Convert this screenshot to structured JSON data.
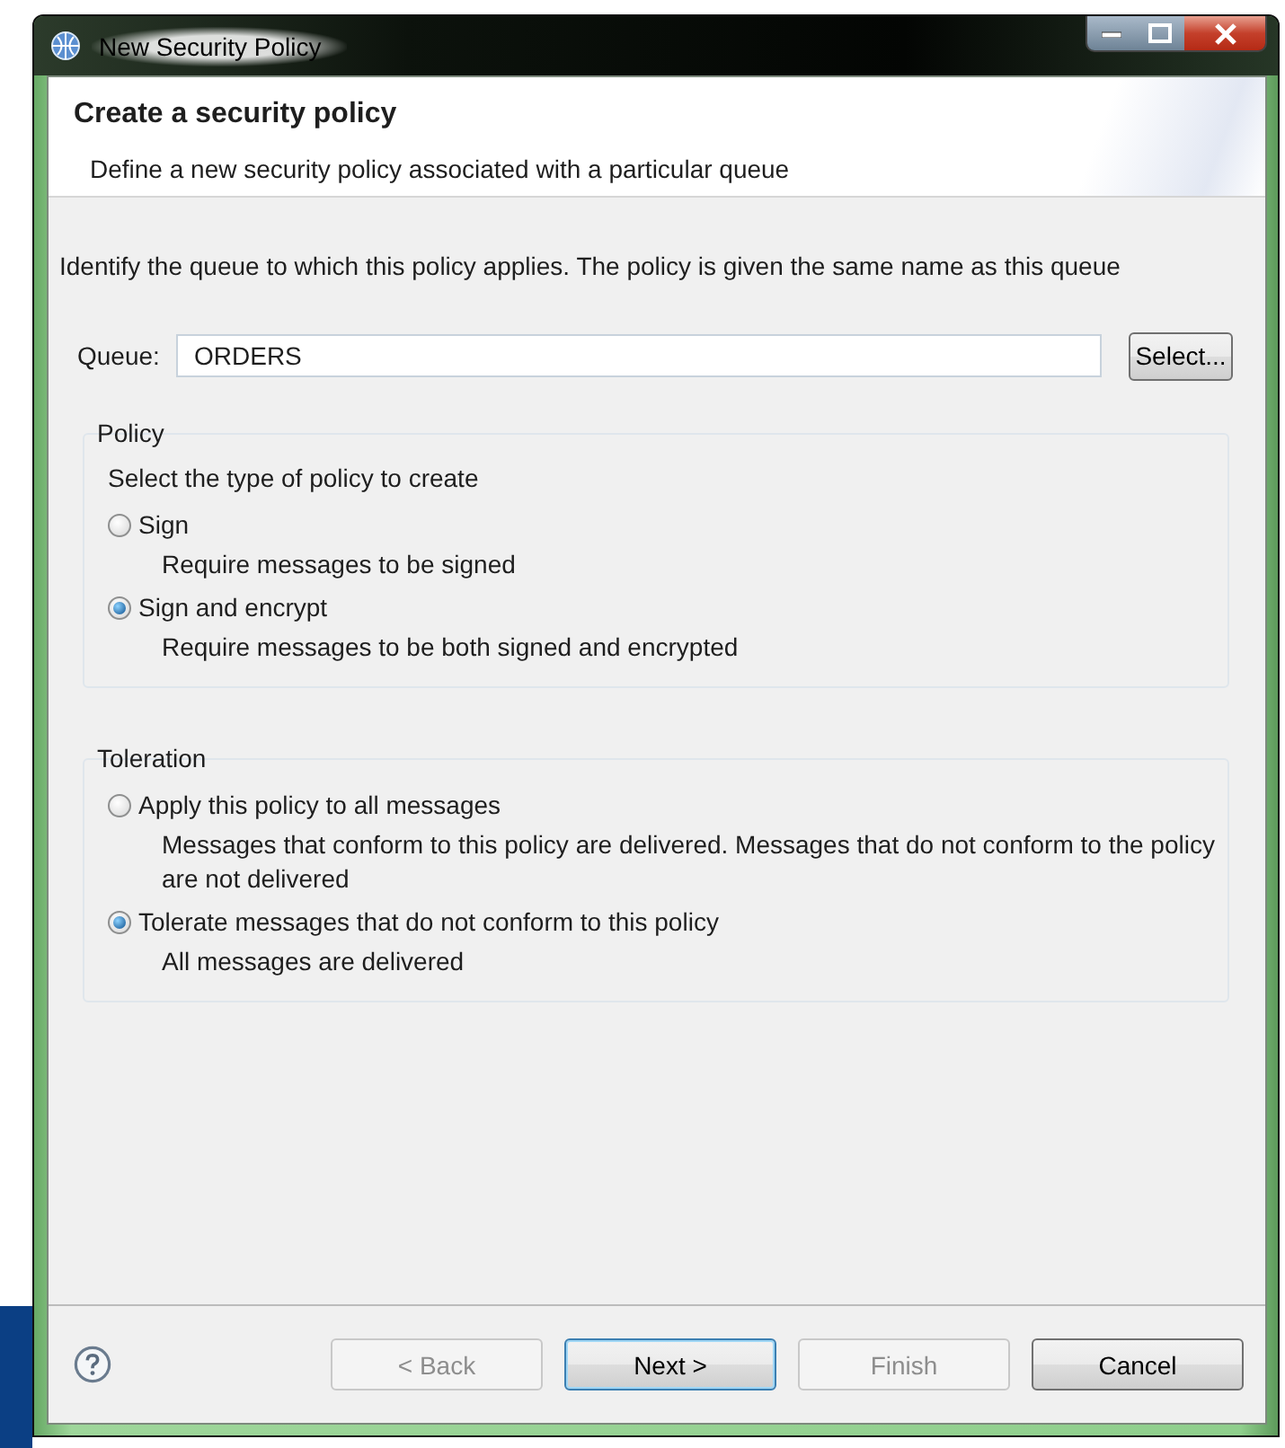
{
  "window": {
    "title": "New Security Policy"
  },
  "header": {
    "title": "Create a security policy",
    "description": "Define a new security policy associated with a particular queue"
  },
  "instruction": "Identify the queue to which this policy applies. The policy is given the same name as this queue",
  "queue": {
    "label": "Queue:",
    "value": "ORDERS",
    "button": "Select..."
  },
  "groups": [
    {
      "title": "Policy",
      "prompt": "Select the type of policy to create",
      "options": [
        {
          "label": "Sign",
          "description": "Require messages to be signed",
          "selected": false
        },
        {
          "label": "Sign and encrypt",
          "description": "Require messages to be both signed and encrypted",
          "selected": true
        }
      ]
    },
    {
      "title": "Toleration",
      "options": [
        {
          "label": "Apply this policy to all messages",
          "description": "Messages that conform to this policy are delivered. Messages that do not conform to the policy are not delivered",
          "selected": false
        },
        {
          "label": "Tolerate messages that do not conform to this policy",
          "description": "All messages are delivered",
          "selected": true
        }
      ]
    }
  ],
  "buttons": [
    {
      "label": "< Back",
      "disabled": true,
      "default": false
    },
    {
      "label": "Next >",
      "disabled": false,
      "default": true
    },
    {
      "label": "Finish",
      "disabled": true,
      "default": false
    },
    {
      "label": "Cancel",
      "disabled": false,
      "default": false
    }
  ]
}
